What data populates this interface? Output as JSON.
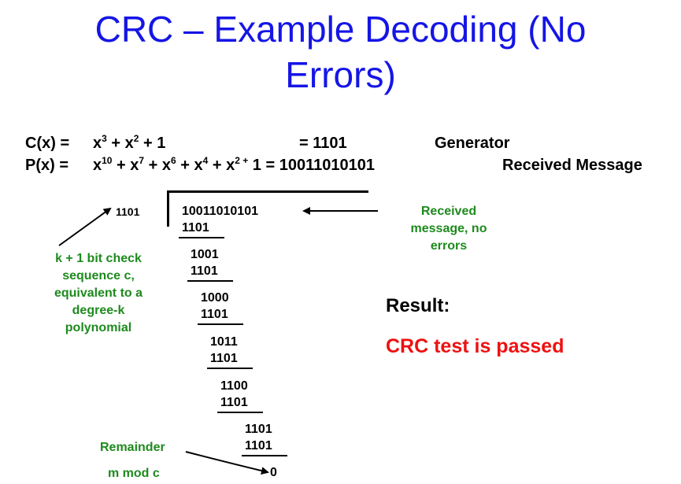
{
  "title": {
    "line1": "CRC – Example Decoding (No",
    "line2": "Errors)"
  },
  "equations": {
    "c_label": "C(x) =",
    "c_expr_html": "x<sup>3</sup> + x<sup>2</sup> + 1",
    "c_value": "= 1101",
    "c_desc": "Generator",
    "p_label": "P(x) =",
    "p_expr_html": "x<sup>10</sup> + x<sup>7</sup> + x<sup>6</sup> + x<sup>4</sup> + x<sup>2 +</sup> 1 = 10011010101",
    "p_desc": "Received Message"
  },
  "division": {
    "divisor": "1101",
    "dividend": "10011010101",
    "steps": [
      {
        "top": "",
        "sub": "1101"
      },
      {
        "top": "1001",
        "sub": "1101"
      },
      {
        "top": "1000",
        "sub": "1101"
      },
      {
        "top": "1011",
        "sub": "1101"
      },
      {
        "top": "1100",
        "sub": "1101"
      },
      {
        "top": "1101",
        "sub": "1101"
      }
    ],
    "remainder": "0"
  },
  "annotations": {
    "received": [
      "Received",
      "message, no",
      "errors"
    ],
    "check_sequence": [
      "k + 1 bit check",
      "sequence c,",
      "equivalent to a",
      "degree-k",
      "polynomial"
    ],
    "remainder_label": "Remainder",
    "mod_label": "m mod c"
  },
  "result": {
    "label": "Result:",
    "value": "CRC test is passed"
  },
  "colors": {
    "title": "#1515e6",
    "annotation": "#1e8a1e",
    "passed": "#ee1111"
  }
}
